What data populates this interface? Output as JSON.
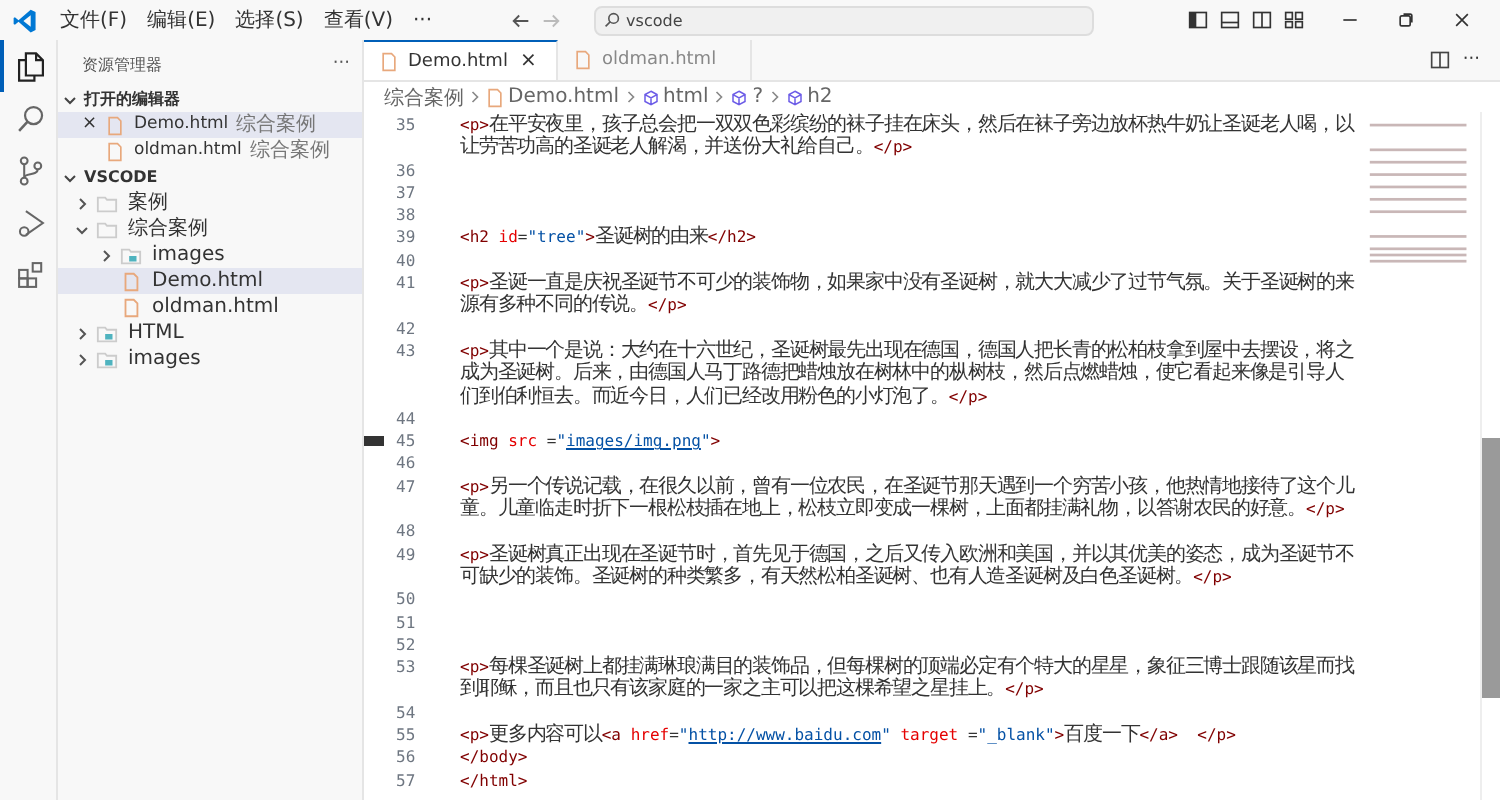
{
  "menu": [
    "文件(F)",
    "编辑(E)",
    "选择(S)",
    "查看(V)",
    "···"
  ],
  "command_center": {
    "text": "vscode"
  },
  "activity_bar": [
    {
      "kind": "files",
      "selected": true
    },
    {
      "kind": "search",
      "selected": false
    },
    {
      "kind": "source-control",
      "selected": false
    },
    {
      "kind": "run",
      "selected": false
    },
    {
      "kind": "extensions",
      "selected": false
    }
  ],
  "explorer": {
    "title": "资源管理器",
    "more": "···",
    "open_editors": {
      "title": "打开的编辑器",
      "expanded": true,
      "items": [
        {
          "name": "Demo.html",
          "folder": "综合案例",
          "selected": true,
          "close": "×"
        },
        {
          "name": "oldman.html",
          "folder": "综合案例",
          "selected": false
        }
      ]
    },
    "workspace": {
      "title": "VSCODE",
      "expanded": true,
      "children": [
        {
          "name": "案例",
          "kind": "folder",
          "expanded": false,
          "selected": false
        },
        {
          "name": "综合案例",
          "kind": "folder",
          "expanded": true,
          "selected": false,
          "children": [
            {
              "name": "images",
              "kind": "image-folder",
              "expanded": false,
              "selected": false
            },
            {
              "name": "Demo.html",
              "kind": "html",
              "selected": true
            },
            {
              "name": "oldman.html",
              "kind": "html",
              "selected": false
            }
          ]
        },
        {
          "name": "HTML",
          "kind": "image-folder",
          "expanded": false,
          "selected": false
        },
        {
          "name": "images",
          "kind": "image-folder",
          "expanded": false,
          "selected": false
        }
      ]
    }
  },
  "tabs": [
    {
      "label": "Demo.html",
      "selected": true,
      "close": "×"
    },
    {
      "label": "oldman.html",
      "selected": false
    }
  ],
  "editor_actions": {
    "more": "···"
  },
  "breadcrumbs": [
    {
      "kind": "folder",
      "text": "综合案例"
    },
    {
      "kind": "file",
      "text": "Demo.html"
    },
    {
      "kind": "symbol",
      "text": "html"
    },
    {
      "kind": "symbol",
      "text": "?"
    },
    {
      "kind": "symbol",
      "text": "h2"
    }
  ],
  "code": [
    {
      "number": "35",
      "marked": false,
      "tokens": [
        {
          "kind": "tag",
          "text": "<p>"
        },
        {
          "kind": "text",
          "text": "在平安夜里，孩子总会把一双双色彩缤纷的袜子挂在床头，然后在袜子旁边放杯热牛奶让圣诞老人喝，以让劳苦功高的圣诞老人解渴，并送份大礼给自己。"
        },
        {
          "kind": "tag",
          "text": "</p>"
        }
      ]
    },
    {
      "number": "36",
      "marked": false
    },
    {
      "number": "37",
      "marked": false
    },
    {
      "number": "38",
      "marked": false
    },
    {
      "number": "39",
      "marked": false,
      "tokens": [
        {
          "kind": "tag",
          "text": "<h2"
        },
        {
          "kind": "attr",
          "text": " id"
        },
        {
          "kind": "op",
          "text": "="
        },
        {
          "kind": "str",
          "text": "\"tree\""
        },
        {
          "kind": "tag",
          "text": ">"
        },
        {
          "kind": "text",
          "text": "圣诞树的由来"
        },
        {
          "kind": "tag",
          "text": "</h2>"
        }
      ]
    },
    {
      "number": "40",
      "marked": false
    },
    {
      "number": "41",
      "marked": false,
      "tokens": [
        {
          "kind": "tag",
          "text": "<p>"
        },
        {
          "kind": "text",
          "text": "圣诞一直是庆祝圣诞节不可少的装饰物，如果家中没有圣诞树，就大大减少了过节气氛。关于圣诞树的来源有多种不同的传说。"
        },
        {
          "kind": "tag",
          "text": "</p>"
        }
      ]
    },
    {
      "number": "42",
      "marked": false
    },
    {
      "number": "43",
      "marked": false,
      "tokens": [
        {
          "kind": "tag",
          "text": "<p>"
        },
        {
          "kind": "text",
          "text": "其中一个是说：大约在十六世纪，圣诞树最先出现在德国，德国人把长青的松柏枝拿到屋中去摆设，将之成为圣诞树。后来，由德国人马丁路德把蜡烛放在树林中的枞树枝，然后点燃蜡烛，使它看起来像是引导人们到伯利恒去。而近今日，人们已经改用粉色的小灯泡了。"
        },
        {
          "kind": "tag",
          "text": "</p>"
        }
      ]
    },
    {
      "number": "44",
      "marked": false
    },
    {
      "number": "45",
      "marked": true,
      "tokens": [
        {
          "kind": "tag",
          "text": "<img"
        },
        {
          "kind": "attr",
          "text": " src "
        },
        {
          "kind": "op",
          "text": "="
        },
        {
          "kind": "str",
          "text": "\""
        },
        {
          "kind": "link",
          "text": "images/img.png"
        },
        {
          "kind": "str",
          "text": "\""
        },
        {
          "kind": "tag",
          "text": ">"
        }
      ]
    },
    {
      "number": "46",
      "marked": false
    },
    {
      "number": "47",
      "marked": false,
      "tokens": [
        {
          "kind": "tag",
          "text": "<p>"
        },
        {
          "kind": "text",
          "text": "另一个传说记载，在很久以前，曾有一位农民，在圣诞节那天遇到一个穷苦小孩，他热情地接待了这个儿童。儿童临走时折下一根松枝插在地上，松枝立即变成一棵树，上面都挂满礼物，以答谢农民的好意。"
        },
        {
          "kind": "tag",
          "text": "</p>"
        }
      ]
    },
    {
      "number": "48",
      "marked": false
    },
    {
      "number": "49",
      "marked": false,
      "tokens": [
        {
          "kind": "tag",
          "text": "<p>"
        },
        {
          "kind": "text",
          "text": "圣诞树真正出现在圣诞节时，首先见于德国，之后又传入欧洲和美国，并以其优美的姿态，成为圣诞节不可缺少的装饰。圣诞树的种类繁多，有天然松柏圣诞树、也有人造圣诞树及白色圣诞树。"
        },
        {
          "kind": "tag",
          "text": "</p>"
        }
      ]
    },
    {
      "number": "50",
      "marked": false
    },
    {
      "number": "51",
      "marked": false
    },
    {
      "number": "52",
      "marked": false
    },
    {
      "number": "53",
      "marked": false,
      "tokens": [
        {
          "kind": "tag",
          "text": "<p>"
        },
        {
          "kind": "text",
          "text": "每棵圣诞树上都挂满琳琅满目的装饰品，但每棵树的顶端必定有个特大的星星，象征三博士跟随该星而找到耶稣，而且也只有该家庭的一家之主可以把这棵希望之星挂上。"
        },
        {
          "kind": "tag",
          "text": "</p>"
        }
      ]
    },
    {
      "number": "54",
      "marked": false
    },
    {
      "number": "55",
      "marked": false,
      "tokens": [
        {
          "kind": "tag",
          "text": "<p>"
        },
        {
          "kind": "text",
          "text": "更多内容可以"
        },
        {
          "kind": "tag",
          "text": "<a"
        },
        {
          "kind": "attr",
          "text": " href"
        },
        {
          "kind": "op",
          "text": "="
        },
        {
          "kind": "str",
          "text": "\""
        },
        {
          "kind": "link",
          "text": "http://www.baidu.com"
        },
        {
          "kind": "str",
          "text": "\""
        },
        {
          "kind": "attr",
          "text": " target "
        },
        {
          "kind": "op",
          "text": "="
        },
        {
          "kind": "str",
          "text": "\"_blank\""
        },
        {
          "kind": "tag",
          "text": ">"
        },
        {
          "kind": "text",
          "text": "百度一下"
        },
        {
          "kind": "tag",
          "text": "</a>"
        },
        {
          "kind": "tag",
          "text": "  </p>"
        }
      ]
    },
    {
      "number": "56",
      "marked": false,
      "tokens": [
        {
          "kind": "tag",
          "text": "</body>"
        }
      ]
    },
    {
      "number": "57",
      "marked": false,
      "tokens": [
        {
          "kind": "tag",
          "text": "</html>"
        }
      ]
    }
  ]
}
